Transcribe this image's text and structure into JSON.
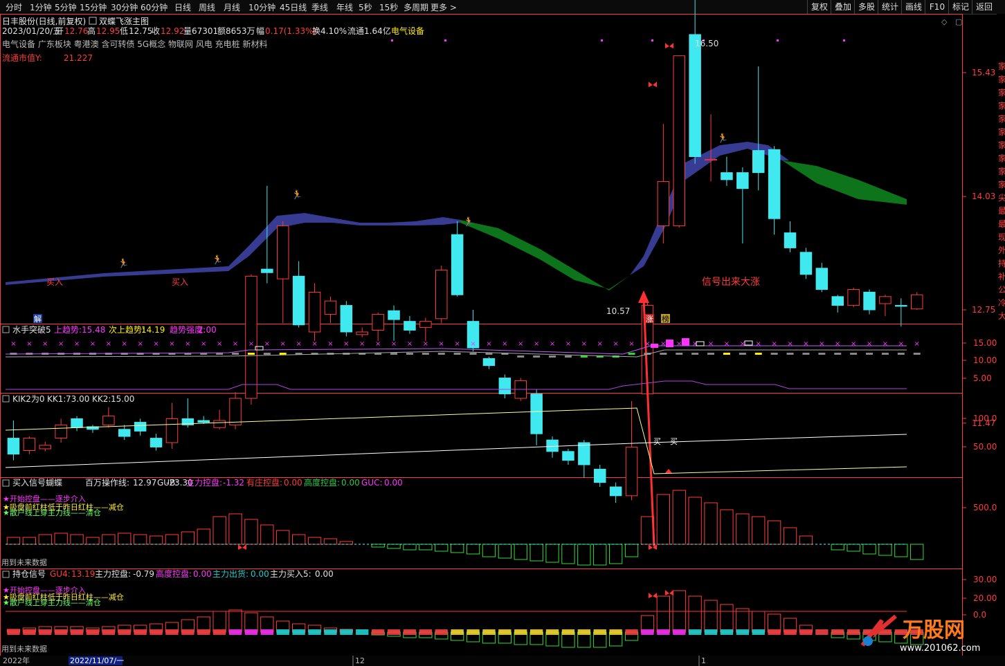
{
  "toolbar": {
    "periods": [
      "分时",
      "1分钟",
      "5分钟",
      "15分钟",
      "30分钟",
      "60分钟",
      "日线",
      "周线",
      "月线",
      "10分钟",
      "45日线",
      "季线",
      "年线",
      "5秒",
      "15秒",
      "多周期",
      "更多 >"
    ],
    "right_buttons": [
      "复权",
      "叠加",
      "多股",
      "统计",
      "画线",
      "F10",
      "标记",
      "返回"
    ]
  },
  "header": {
    "stock_title": "日丰股份(日线,前复权)",
    "indicator_title": "双蝶飞涨主图",
    "date": "2023/01/20/五",
    "open_label": "开",
    "open": "12.76",
    "high_label": "高",
    "high": "12.95",
    "low_label": "低",
    "low": "12.75",
    "close_label": "收",
    "close": "12.92",
    "volume": "量67301",
    "amount": "额8653万",
    "change_label": "幅",
    "change": "0.17(1.33%)",
    "turnover": "换4.10%",
    "float_shares": "流通1.64亿",
    "industry": "电气设备",
    "concepts": "电气设备 广东板块 粤港澳 含可转债 5G概念 物联网 风电 充电桩 新材料",
    "mcap_label": "流通市值Y:",
    "mcap_value": "21.227"
  },
  "main_panel": {
    "price_axis": [
      "15.43",
      "14.03",
      "12.75",
      "11.47"
    ],
    "high_marker": "16.50",
    "low_marker": "10.57",
    "annotation": "信号出来大涨",
    "buy_label": "买入",
    "tags": {
      "jie": "解",
      "zhang": "涨",
      "bang": "榜"
    },
    "side_letters": [
      "家",
      "家",
      "家",
      "家",
      "家",
      "家",
      "家",
      "家",
      "家",
      "家",
      "尖",
      "最",
      "最",
      "现",
      "外",
      "持",
      "补",
      "公",
      "冷",
      "大"
    ]
  },
  "panel1": {
    "name": "水手突破5",
    "l1_label": "上趋势:",
    "l1_value": "15.48",
    "l2_label": "次上趋势:",
    "l2_value": "14.19",
    "l3_label": "趋势强度:",
    "l3_value": "2.00",
    "axis": [
      "15.00",
      "10.00",
      "5.00"
    ]
  },
  "panel2": {
    "name": "KIK2为0",
    "p1_label": "KK1:",
    "p1_value": "73.00",
    "p2_label": "KK2:",
    "p2_value": "15.00",
    "axis": [
      "100.0",
      "50.00"
    ],
    "buy_char": "买"
  },
  "panel3": {
    "name": "买入信号蝴蝶",
    "p1_label": "百万操作线:",
    "p1_value": "12.97",
    "p2_label": "GUB:",
    "p2_value": "-23.30",
    "p3_label": "主力控盘:",
    "p3_value": "-1.32",
    "p4_label": "有庄控盘:",
    "p4_value": "0.00",
    "p5_label": "高度控盘:",
    "p5_value": "0.00",
    "p6_label": "GUC:",
    "p6_value": "0.00",
    "axis": [
      "500.0"
    ],
    "legend1": "★开始控盘——逐步介入",
    "legend2": "★吸盘前红柱低于昨日红柱——减仓",
    "legend3": "★散户线上穿主力线——清仓",
    "footer": "用到未来数据"
  },
  "panel4": {
    "name": "持仓信号",
    "p1_label": "GU4:",
    "p1_value": "13.19",
    "p2_label": "主力控盘:",
    "p2_value": "-0.79",
    "p3_label": "高度控盘:",
    "p3_value": "0.00",
    "p4_label": "主力出货:",
    "p4_value": "0.00",
    "p5_label": "主力买入5:",
    "p5_value": "0.00",
    "axis": [
      "30.00",
      "20.00",
      "0.0"
    ],
    "legend1": "★开始控盘——逐步介入",
    "legend2": "★吸盘前红柱低于昨日红柱——减仓",
    "legend3": "★散户线上穿主力线——清仓",
    "footer": "用到未来数据"
  },
  "timeline": {
    "year": "2022年",
    "cursor_date": "2022/11/07/一",
    "m12": "12",
    "m1": "1"
  },
  "watermark": {
    "brand": "万股网",
    "url": "www.201062.com"
  },
  "colors": {
    "up": "#ff3b3b",
    "down": "#40e8f0",
    "cloud_up": "#3a3f9a",
    "cloud_down": "#0f7a1d",
    "axis": "#ff3b3b",
    "magenta": "#ff33ff",
    "yellow": "#ffee00"
  },
  "chart_data": {
    "type": "candlestick",
    "price_range": [
      10.0,
      17.0
    ],
    "candles": [
      {
        "o": 11.3,
        "c": 11.12,
        "h": 11.5,
        "l": 11.05
      },
      {
        "o": 11.16,
        "c": 11.3,
        "h": 11.32,
        "l": 11.12
      },
      {
        "o": 11.18,
        "c": 11.22,
        "h": 11.26,
        "l": 11.15
      },
      {
        "o": 11.3,
        "c": 11.45,
        "h": 11.52,
        "l": 11.25
      },
      {
        "o": 11.52,
        "c": 11.42,
        "h": 11.55,
        "l": 11.38
      },
      {
        "o": 11.43,
        "c": 11.4,
        "h": 11.45,
        "l": 11.36
      },
      {
        "o": 11.45,
        "c": 11.55,
        "h": 11.65,
        "l": 11.42
      },
      {
        "o": 11.4,
        "c": 11.32,
        "h": 11.45,
        "l": 11.28
      },
      {
        "o": 11.48,
        "c": 11.38,
        "h": 11.52,
        "l": 11.33
      },
      {
        "o": 11.3,
        "c": 11.2,
        "h": 11.35,
        "l": 11.16
      },
      {
        "o": 11.25,
        "c": 11.52,
        "h": 11.7,
        "l": 11.18
      },
      {
        "o": 11.52,
        "c": 11.45,
        "h": 11.75,
        "l": 11.42
      },
      {
        "o": 11.5,
        "c": 11.48,
        "h": 11.55,
        "l": 11.46
      },
      {
        "o": 11.42,
        "c": 11.5,
        "h": 11.62,
        "l": 11.4
      },
      {
        "o": 11.45,
        "c": 11.75,
        "h": 11.82,
        "l": 11.4
      },
      {
        "o": 11.75,
        "c": 13.13,
        "h": 13.15,
        "l": 11.68
      },
      {
        "o": 13.21,
        "c": 13.17,
        "h": 14.15,
        "l": 13.05
      },
      {
        "o": 13.1,
        "c": 13.7,
        "h": 13.75,
        "l": 12.6
      },
      {
        "o": 13.13,
        "c": 12.58,
        "h": 13.3,
        "l": 12.55
      },
      {
        "o": 12.5,
        "c": 12.95,
        "h": 13.05,
        "l": 12.4
      },
      {
        "o": 12.7,
        "c": 12.85,
        "h": 12.9,
        "l": 12.6
      },
      {
        "o": 12.8,
        "c": 12.5,
        "h": 12.85,
        "l": 12.45
      },
      {
        "o": 12.47,
        "c": 12.5,
        "h": 12.55,
        "l": 12.44
      },
      {
        "o": 12.52,
        "c": 12.7,
        "h": 12.72,
        "l": 12.4
      },
      {
        "o": 12.74,
        "c": 12.64,
        "h": 12.8,
        "l": 12.4
      },
      {
        "o": 12.62,
        "c": 12.52,
        "h": 12.68,
        "l": 12.48
      },
      {
        "o": 12.55,
        "c": 12.62,
        "h": 12.66,
        "l": 12.4
      },
      {
        "o": 12.65,
        "c": 13.2,
        "h": 13.25,
        "l": 12.6
      },
      {
        "o": 13.6,
        "c": 12.92,
        "h": 13.75,
        "l": 12.9
      },
      {
        "o": 12.62,
        "c": 12.32,
        "h": 12.75,
        "l": 12.28
      },
      {
        "o": 12.2,
        "c": 12.12,
        "h": 12.22,
        "l": 12.08
      },
      {
        "o": 11.98,
        "c": 11.8,
        "h": 12.02,
        "l": 11.75
      },
      {
        "o": 11.75,
        "c": 11.95,
        "h": 11.98,
        "l": 11.72
      },
      {
        "o": 11.8,
        "c": 11.35,
        "h": 11.85,
        "l": 11.22
      },
      {
        "o": 11.28,
        "c": 11.15,
        "h": 11.32,
        "l": 11.08
      },
      {
        "o": 11.15,
        "c": 11.05,
        "h": 11.18,
        "l": 11.0
      },
      {
        "o": 11.25,
        "c": 11.0,
        "h": 11.28,
        "l": 10.85
      },
      {
        "o": 10.95,
        "c": 10.8,
        "h": 11.0,
        "l": 10.75
      },
      {
        "o": 10.75,
        "c": 10.65,
        "h": 10.8,
        "l": 10.57
      },
      {
        "o": 10.65,
        "c": 11.2,
        "h": 11.72,
        "l": 10.6
      },
      {
        "o": 11.8,
        "c": 12.8,
        "h": 12.85,
        "l": 11.78
      },
      {
        "o": 13.7,
        "c": 14.2,
        "h": 14.85,
        "l": 13.5
      },
      {
        "o": 13.7,
        "c": 15.62,
        "h": 15.62,
        "l": 13.68
      },
      {
        "o": 15.86,
        "c": 14.48,
        "h": 16.5,
        "l": 14.4
      },
      {
        "o": 14.44,
        "c": 14.45,
        "h": 14.96,
        "l": 14.2
      },
      {
        "o": 14.3,
        "c": 14.22,
        "h": 14.48,
        "l": 14.15
      },
      {
        "o": 14.3,
        "c": 14.12,
        "h": 14.36,
        "l": 13.5
      },
      {
        "o": 14.55,
        "c": 14.3,
        "h": 15.5,
        "l": 14.1
      },
      {
        "o": 14.56,
        "c": 13.78,
        "h": 14.6,
        "l": 13.6
      },
      {
        "o": 13.62,
        "c": 13.45,
        "h": 13.75,
        "l": 13.4
      },
      {
        "o": 13.4,
        "c": 13.15,
        "h": 13.45,
        "l": 13.1
      },
      {
        "o": 13.22,
        "c": 12.98,
        "h": 13.28,
        "l": 12.95
      },
      {
        "o": 12.9,
        "c": 12.8,
        "h": 12.92,
        "l": 12.72
      },
      {
        "o": 12.8,
        "c": 12.98,
        "h": 13.0,
        "l": 12.78
      },
      {
        "o": 12.95,
        "c": 12.75,
        "h": 12.98,
        "l": 12.7
      },
      {
        "o": 12.82,
        "c": 12.9,
        "h": 12.92,
        "l": 12.68
      },
      {
        "o": 12.8,
        "c": 12.79,
        "h": 12.88,
        "l": 12.56
      },
      {
        "o": 12.76,
        "c": 12.92,
        "h": 12.95,
        "l": 12.75
      }
    ]
  }
}
